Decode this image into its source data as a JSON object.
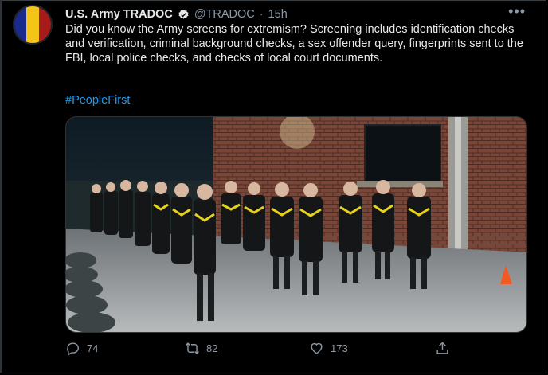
{
  "colors": {
    "background": "#000000",
    "text": "#e7e9ea",
    "muted": "#8b98a5",
    "link": "#1d9bf0"
  },
  "tweet": {
    "author_name": "U.S. Army TRADOC",
    "handle": "@TRADOC",
    "separator": "·",
    "time": "15h",
    "body": "Did you know the Army screens for extremism? Screening includes identification checks and verification, criminal background checks, a sex offender query, fingerprints sent to the FBI, local police checks, and checks of local court documents.",
    "hashtag": "#PeopleFirst",
    "more_icon": "more-horizontal-icon",
    "verified_icon": "verified-badge-icon"
  },
  "avatar": {
    "stripe_colors": [
      "#1a2a8c",
      "#f4c418",
      "#a61b1b"
    ]
  },
  "media": {
    "description_icon": "photo"
  },
  "actions": {
    "reply_count": "74",
    "retweet_count": "82",
    "like_count": "173",
    "reply_icon": "reply-icon",
    "retweet_icon": "retweet-icon",
    "like_icon": "heart-icon",
    "share_icon": "share-icon"
  }
}
